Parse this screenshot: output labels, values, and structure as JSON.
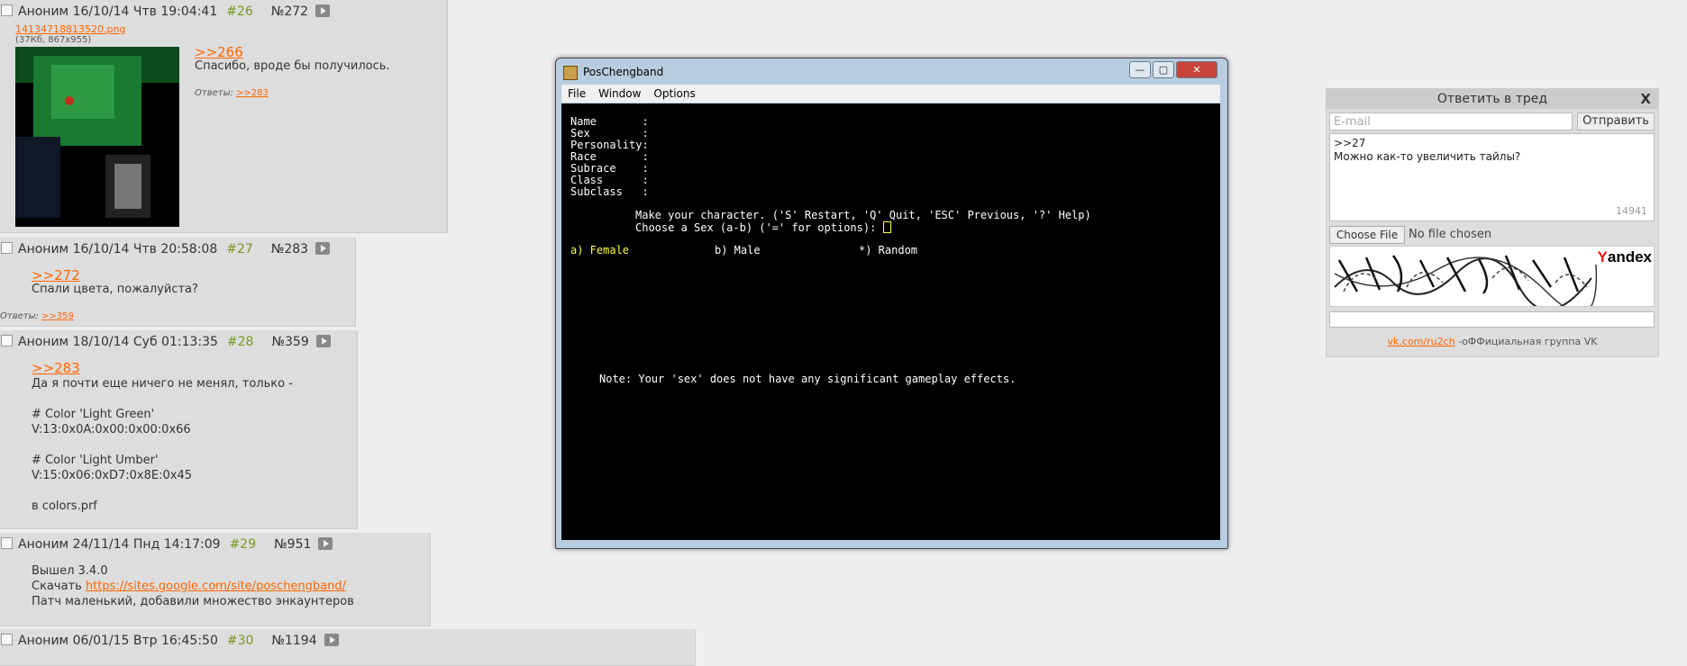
{
  "posts": [
    {
      "author": "Аноним",
      "date": "16/10/14 Чтв 19:04:41",
      "num": "#26",
      "id": "№272",
      "file_name": "14134718813520.png",
      "file_meta": "(37Кб, 867x955)",
      "reply_ref": ">>266",
      "text": "Спасибо, вроде бы получилось.",
      "answers_label": "Ответы:",
      "answers": ">>283"
    },
    {
      "author": "Аноним",
      "date": "16/10/14 Чтв 20:58:08",
      "num": "#27",
      "id": "№283",
      "reply_ref": ">>272",
      "text": "Спали цвета, пожалуйста?",
      "answers_label": "Ответы:",
      "answers": ">>359"
    },
    {
      "author": "Аноним",
      "date": "18/10/14 Суб 01:13:35",
      "num": "#28",
      "id": "№359",
      "reply_ref": ">>283",
      "text": "Да я почти еще ничего не менял, только -\n\n# Color 'Light Green'\nV:13:0x0A:0x00:0x00:0x66\n\n# Color 'Light Umber'\nV:15:0x06:0xD7:0x8E:0x45\n\nв colors.prf"
    },
    {
      "author": "Аноним",
      "date": "24/11/14 Пнд 14:17:09",
      "num": "#29",
      "id": "№951",
      "line1": "Вышел 3.4.0",
      "line2_prefix": "Скачать ",
      "link": "https://sites.google.com/site/poschengband/",
      "line3": "Патч маленький, добавили множество энкаунтеров"
    },
    {
      "author": "Аноним",
      "date": "06/01/15 Втр 16:45:50",
      "num": "#30",
      "id": "№1194"
    }
  ],
  "window": {
    "title": "PosChengband",
    "menu": [
      "File",
      "Window",
      "Options"
    ],
    "buttons": {
      "minimize": "—",
      "maximize": "▢",
      "close": "✕"
    }
  },
  "terminal": {
    "fields": [
      "Name       :",
      "Sex        :",
      "Personality:",
      "Race       :",
      "Subrace    :",
      "Class      :",
      "Subclass   :"
    ],
    "prompt1": "Make your character. ('S' Restart, 'Q' Quit, 'ESC' Previous, '?' Help)",
    "prompt2": "Choose a Sex (a-b) ('=' for options): ",
    "option_a": "a) Female",
    "option_b": "b) Male",
    "option_c": "*) Random",
    "note": "Note: Your 'sex' does not have any significant gameplay effects."
  },
  "reply_form": {
    "title": "Ответить в тред",
    "close": "X",
    "email_placeholder": "E-mail",
    "send": "Отправить",
    "message": ">>27\nМожно как-то увеличить тайлы?",
    "counter": "14941",
    "choose_file": "Choose File",
    "no_file": "No file chosen",
    "captcha_brand_first": "Y",
    "captcha_brand_rest": "andex",
    "footer_link": "vk.com/ru2ch",
    "footer_text": " -оФФициальная группа VK"
  }
}
